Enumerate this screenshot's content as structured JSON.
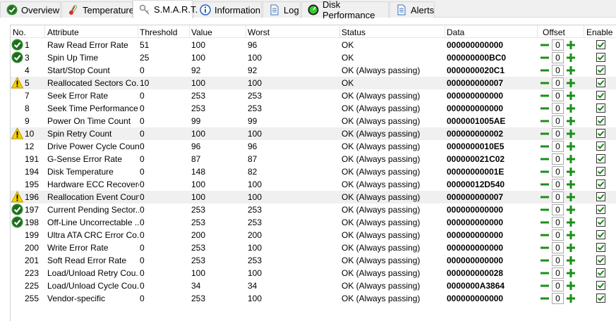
{
  "tabs": [
    {
      "label": "Overview",
      "icon": "check-circle-icon",
      "active": false
    },
    {
      "label": "Temperature",
      "icon": "thermometer-icon",
      "active": false
    },
    {
      "label": "S.M.A.R.T.",
      "icon": "key-icon",
      "active": true
    },
    {
      "label": "Information",
      "icon": "info-icon",
      "active": false
    },
    {
      "label": "Log",
      "icon": "log-document-icon",
      "active": false
    },
    {
      "label": "Disk Performance",
      "icon": "gauge-icon",
      "active": false
    },
    {
      "label": "Alerts",
      "icon": "alerts-document-icon",
      "active": false
    }
  ],
  "columns": [
    "No.",
    "Attribute",
    "Threshold",
    "Value",
    "Worst",
    "Status",
    "Data",
    "Offset",
    "Enable"
  ],
  "colors": {
    "ok_green": "#2e8b2e",
    "warn_yellow": "#f5d000",
    "plus_green": "#1a8f1a",
    "alt_row": "#f0f0f0"
  },
  "rows": [
    {
      "no": "1",
      "attribute": "Raw Read Error Rate",
      "threshold": "51",
      "value": "100",
      "worst": "96",
      "status": "OK",
      "data": "000000000000",
      "offset": "0",
      "icon": "ok",
      "alt": false
    },
    {
      "no": "3",
      "attribute": "Spin Up Time",
      "threshold": "25",
      "value": "100",
      "worst": "100",
      "status": "OK",
      "data": "000000000BC0",
      "offset": "0",
      "icon": "ok",
      "alt": false
    },
    {
      "no": "4",
      "attribute": "Start/Stop Count",
      "threshold": "0",
      "value": "92",
      "worst": "92",
      "status": "OK (Always passing)",
      "data": "0000000020C1",
      "offset": "0",
      "icon": "",
      "alt": false
    },
    {
      "no": "5",
      "attribute": "Reallocated Sectors Co...",
      "threshold": "10",
      "value": "100",
      "worst": "100",
      "status": "OK",
      "data": "000000000007",
      "offset": "0",
      "icon": "warn",
      "alt": true
    },
    {
      "no": "7",
      "attribute": "Seek Error Rate",
      "threshold": "0",
      "value": "253",
      "worst": "253",
      "status": "OK (Always passing)",
      "data": "000000000000",
      "offset": "0",
      "icon": "",
      "alt": false
    },
    {
      "no": "8",
      "attribute": "Seek Time Performance",
      "threshold": "0",
      "value": "253",
      "worst": "253",
      "status": "OK (Always passing)",
      "data": "000000000000",
      "offset": "0",
      "icon": "",
      "alt": false
    },
    {
      "no": "9",
      "attribute": "Power On Time Count",
      "threshold": "0",
      "value": "99",
      "worst": "99",
      "status": "OK (Always passing)",
      "data": "0000001005AE",
      "offset": "0",
      "icon": "",
      "alt": false
    },
    {
      "no": "10",
      "attribute": "Spin Retry Count",
      "threshold": "0",
      "value": "100",
      "worst": "100",
      "status": "OK (Always passing)",
      "data": "000000000002",
      "offset": "0",
      "icon": "warn",
      "alt": true
    },
    {
      "no": "12",
      "attribute": "Drive Power Cycle Count",
      "threshold": "0",
      "value": "96",
      "worst": "96",
      "status": "OK (Always passing)",
      "data": "0000000010E5",
      "offset": "0",
      "icon": "",
      "alt": false
    },
    {
      "no": "191",
      "attribute": "G-Sense Error Rate",
      "threshold": "0",
      "value": "87",
      "worst": "87",
      "status": "OK (Always passing)",
      "data": "000000021C02",
      "offset": "0",
      "icon": "",
      "alt": false
    },
    {
      "no": "194",
      "attribute": "Disk Temperature",
      "threshold": "0",
      "value": "148",
      "worst": "82",
      "status": "OK (Always passing)",
      "data": "00000000001E",
      "offset": "0",
      "icon": "",
      "alt": false
    },
    {
      "no": "195",
      "attribute": "Hardware ECC Recovered",
      "threshold": "0",
      "value": "100",
      "worst": "100",
      "status": "OK (Always passing)",
      "data": "00000012D540",
      "offset": "0",
      "icon": "",
      "alt": false
    },
    {
      "no": "196",
      "attribute": "Reallocation Event Count",
      "threshold": "0",
      "value": "100",
      "worst": "100",
      "status": "OK (Always passing)",
      "data": "000000000007",
      "offset": "0",
      "icon": "warn",
      "alt": true
    },
    {
      "no": "197",
      "attribute": "Current Pending Sector...",
      "threshold": "0",
      "value": "253",
      "worst": "253",
      "status": "OK (Always passing)",
      "data": "000000000000",
      "offset": "0",
      "icon": "ok",
      "alt": false
    },
    {
      "no": "198",
      "attribute": "Off-Line Uncorrectable ...",
      "threshold": "0",
      "value": "253",
      "worst": "253",
      "status": "OK (Always passing)",
      "data": "000000000000",
      "offset": "0",
      "icon": "ok",
      "alt": false
    },
    {
      "no": "199",
      "attribute": "Ultra ATA CRC Error Co...",
      "threshold": "0",
      "value": "200",
      "worst": "200",
      "status": "OK (Always passing)",
      "data": "000000000000",
      "offset": "0",
      "icon": "",
      "alt": false
    },
    {
      "no": "200",
      "attribute": "Write Error Rate",
      "threshold": "0",
      "value": "253",
      "worst": "100",
      "status": "OK (Always passing)",
      "data": "000000000000",
      "offset": "0",
      "icon": "",
      "alt": false
    },
    {
      "no": "201",
      "attribute": "Soft Read Error Rate",
      "threshold": "0",
      "value": "253",
      "worst": "253",
      "status": "OK (Always passing)",
      "data": "000000000000",
      "offset": "0",
      "icon": "",
      "alt": false
    },
    {
      "no": "223",
      "attribute": "Load/Unload Retry Cou...",
      "threshold": "0",
      "value": "100",
      "worst": "100",
      "status": "OK (Always passing)",
      "data": "000000000028",
      "offset": "0",
      "icon": "",
      "alt": false
    },
    {
      "no": "225",
      "attribute": "Load/Unload Cycle Cou...",
      "threshold": "0",
      "value": "34",
      "worst": "34",
      "status": "OK (Always passing)",
      "data": "0000000A3864",
      "offset": "0",
      "icon": "",
      "alt": false
    },
    {
      "no": "255",
      "attribute": "Vendor-specific",
      "threshold": "0",
      "value": "253",
      "worst": "100",
      "status": "OK (Always passing)",
      "data": "000000000000",
      "offset": "0",
      "icon": "",
      "alt": false
    }
  ]
}
